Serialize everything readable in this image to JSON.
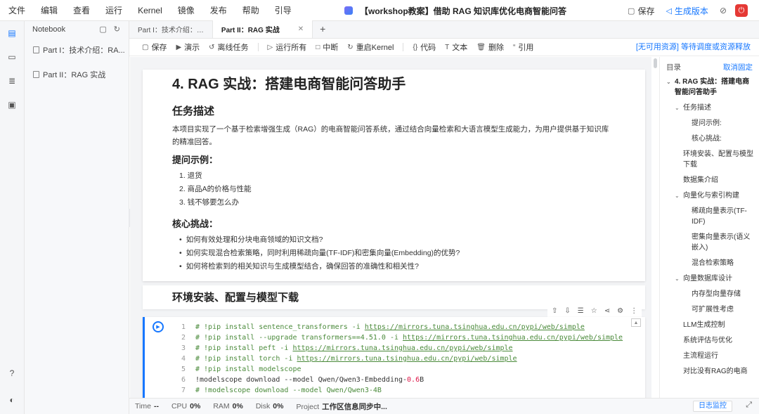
{
  "menu": [
    "文件",
    "编辑",
    "查看",
    "运行",
    "Kernel",
    "镜像",
    "发布",
    "帮助",
    "引导"
  ],
  "window_title": "【workshop教案】借助 RAG 知识库优化电商智能问答",
  "header_actions": {
    "save": "保存",
    "generate": "生成版本"
  },
  "file_panel": {
    "title": "Notebook",
    "files": [
      "Part I：技术介绍：RA...",
      "Part II：RAG 实战"
    ]
  },
  "tabs": [
    {
      "label": "Part I：技术介绍：…",
      "active": false
    },
    {
      "label": "Part II：RAG 实战",
      "active": true
    }
  ],
  "toolbar": {
    "save": "保存",
    "present": "演示",
    "offline": "离线任务",
    "run_all": "运行所有",
    "interrupt": "中断",
    "restart": "重启Kernel",
    "code": "代码",
    "text": "文本",
    "delete": "删除",
    "cite": "引用",
    "status": "[无可用资源] 等待调度或资源释放"
  },
  "notebook": {
    "h1": "4. RAG 实战：搭建电商智能问答助手",
    "task_title": "任务描述",
    "task_desc": "本项目实现了一个基于检索增强生成（RAG）的电商智能问答系统，通过结合向量检索和大语言模型生成能力，为用户提供基于知识库的精准回答。",
    "examples_title": "提问示例：",
    "examples": [
      "1. 退货",
      "2. 商品A的价格与性能",
      "3. 钱不够要怎么办"
    ],
    "challenges_title": "核心挑战：",
    "challenges": [
      "如何有效处理和分块电商领域的知识文档?",
      "如何实现混合检索策略，同时利用稀疏向量(TF-IDF)和密集向量(Embedding)的优势?",
      "如何将检索到的相关知识与生成模型结合，确保回答的准确性和相关性?"
    ],
    "env_title": "环境安装、配置与模型下载",
    "code_lines": [
      {
        "n": "1",
        "pre": "# !pip install sentence_transformers -i ",
        "url": "https://mirrors.tuna.tsinghua.edu.cn/pypi/web/simple",
        "comment": true
      },
      {
        "n": "2",
        "pre": "# !pip install --upgrade transformers==4.51.0 -i ",
        "url": "https://mirrors.tuna.tsinghua.edu.cn/pypi/web/simple",
        "comment": true
      },
      {
        "n": "3",
        "pre": "# !pip install peft -i ",
        "url": "https://mirrors.tuna.tsinghua.edu.cn/pypi/web/simple",
        "comment": true
      },
      {
        "n": "4",
        "pre": "# !pip install torch -i ",
        "url": "https://mirrors.tuna.tsinghua.edu.cn/pypi/web/simple",
        "comment": true
      },
      {
        "n": "5",
        "pre": "# !pip install modelscope",
        "url": "",
        "comment": true
      },
      {
        "n": "6",
        "pre": "!modelscope download --model Qwen/Qwen3-Embedding-",
        "num": "0.6",
        "post": "B",
        "comment": false
      },
      {
        "n": "7",
        "pre": "# !modelscope download --model Qwen/Qwen3-4B",
        "url": "",
        "comment": true
      }
    ]
  },
  "toc": {
    "title": "目录",
    "unpin": "取消固定",
    "items": [
      {
        "label": "4. RAG 实战：搭建电商智能问答助手",
        "level": "l1",
        "chev": "⌄"
      },
      {
        "label": "任务描述",
        "level": "l2",
        "chev": "⌄"
      },
      {
        "label": "提问示例:",
        "level": "l3",
        "chev": ""
      },
      {
        "label": "核心挑战:",
        "level": "l3",
        "chev": ""
      },
      {
        "label": "环境安装、配置与模型下载",
        "level": "l2 noch",
        "chev": ""
      },
      {
        "label": "数据集介绍",
        "level": "l2 noch",
        "chev": ""
      },
      {
        "label": "向量化与索引构建",
        "level": "l2",
        "chev": "⌄"
      },
      {
        "label": "稀疏向量表示(TF-IDF)",
        "level": "l3",
        "chev": ""
      },
      {
        "label": "密集向量表示(语义嵌入)",
        "level": "l3",
        "chev": ""
      },
      {
        "label": "混合检索策略",
        "level": "l3",
        "chev": ""
      },
      {
        "label": "向量数据库设计",
        "level": "l2",
        "chev": "⌄"
      },
      {
        "label": "内存型向量存储",
        "level": "l3",
        "chev": ""
      },
      {
        "label": "可扩展性考虑",
        "level": "l3",
        "chev": ""
      },
      {
        "label": "LLM生成控制",
        "level": "l2 noch",
        "chev": ""
      },
      {
        "label": "系统评估与优化",
        "level": "l2 noch",
        "chev": ""
      },
      {
        "label": "主流程运行",
        "level": "l2 noch",
        "chev": ""
      },
      {
        "label": "对比没有RAG的电商",
        "level": "l2 noch",
        "chev": ""
      }
    ]
  },
  "status": {
    "time_label": "Time",
    "time_val": "--",
    "cpu_label": "CPU",
    "cpu_val": "0%",
    "ram_label": "RAM",
    "ram_val": "0%",
    "disk_label": "Disk",
    "disk_val": "0%",
    "project_label": "Project",
    "project_val": "工作区信息同步中...",
    "monitor": "日志监控"
  }
}
